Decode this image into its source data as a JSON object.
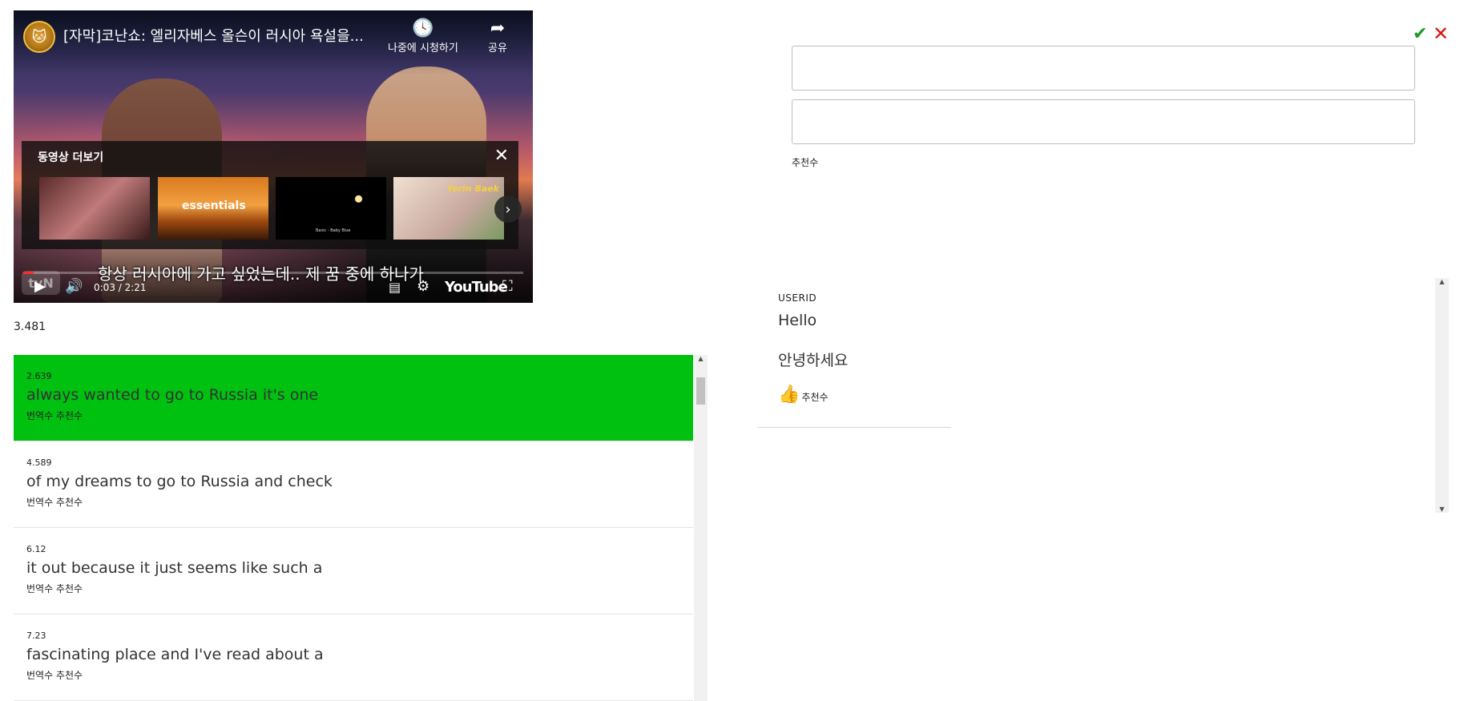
{
  "video": {
    "title": "[자막]코난쇼: 엘리자베스 올슨이 러시아 욕설을...",
    "watch_later_label": "나중에 시청하기",
    "share_label": "공유",
    "more_videos_title": "동영상 더보기",
    "thumbnails": [
      {
        "name": "thumb-interview",
        "text": ""
      },
      {
        "name": "thumb-essentials",
        "text": "essentials"
      },
      {
        "name": "thumb-night-sky",
        "text": "Basic - Baby Blue"
      },
      {
        "name": "thumb-yerin-baek",
        "text": "Yerin Baek"
      }
    ],
    "caption": "항상 러시아에 가고 싶었는데.. 제 꿈 중에 하나가",
    "time": "0:03 / 2:21",
    "progress": 0.021,
    "logo": "YouTube",
    "watermark": "tvN"
  },
  "current_time": "3.481",
  "subtitles": [
    {
      "time": "2.639",
      "text": "always wanted to go to Russia it's one",
      "meta": "번역수 추천수",
      "active": true
    },
    {
      "time": "4.589",
      "text": "of my dreams to go to Russia and check",
      "meta": "번역수 추천수",
      "active": false
    },
    {
      "time": "6.12",
      "text": "it out because it just seems like such a",
      "meta": "번역수 추천수",
      "active": false
    },
    {
      "time": "7.23",
      "text": "fascinating place and I've read about a",
      "meta": "번역수 추천수",
      "active": false
    }
  ],
  "editor": {
    "input1_value": "",
    "input2_value": "",
    "recommend_label": "추천수"
  },
  "comment": {
    "user": "USERID",
    "original": "Hello",
    "translation": "안녕하세요",
    "like_label": "추천수"
  },
  "colors": {
    "active_row": "#00c010",
    "confirm": "#1a9a2a",
    "cancel": "#e01010",
    "like": "#3b4fb0",
    "progress": "#ff0000"
  }
}
